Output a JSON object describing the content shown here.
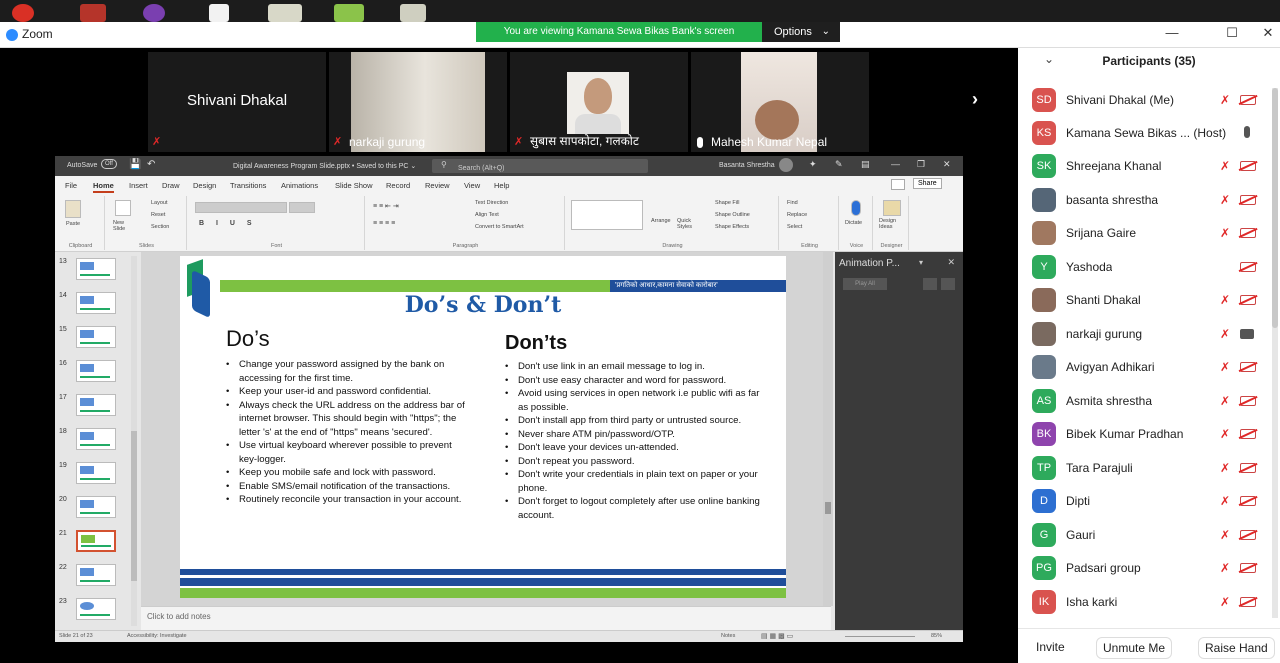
{
  "app": {
    "title": "Zoom"
  },
  "banner": {
    "viewing": "You are viewing Kamana Sewa Bikas Bank's screen",
    "options": "Options"
  },
  "video_tiles": [
    {
      "name": "Shivani Dhakal",
      "muted": true
    },
    {
      "name": "narkaji gurung",
      "muted": true
    },
    {
      "name": "सुबास सापकोटा, गलकोट",
      "muted": true
    },
    {
      "name": "Mahesh Kumar Nepal",
      "muted": false
    }
  ],
  "ppt": {
    "autosave": "AutoSave",
    "autosave_state": "Off",
    "filename": "Digital Awareness Program Slide.pptx • Saved to this PC ⌄",
    "search_placeholder": "Search (Alt+Q)",
    "user": "Basanta Shrestha",
    "share": "Share",
    "menu": [
      "File",
      "Home",
      "Insert",
      "Draw",
      "Design",
      "Transitions",
      "Animations",
      "Slide Show",
      "Record",
      "Review",
      "View",
      "Help"
    ],
    "ribbon": {
      "clipboard": "Clipboard",
      "paste": "Paste",
      "new_slide": "New Slide",
      "layout": "Layout",
      "reset": "Reset",
      "section": "Section",
      "slides": "Slides",
      "font": "Font",
      "paragraph": "Paragraph",
      "text_direction": "Text Direction",
      "align_text": "Align Text",
      "convert_smartart": "Convert to SmartArt",
      "drawing": "Drawing",
      "arrange": "Arrange",
      "quick_styles": "Quick Styles",
      "shape_fill": "Shape Fill",
      "shape_outline": "Shape Outline",
      "shape_effects": "Shape Effects",
      "find": "Find",
      "replace": "Replace",
      "select": "Select",
      "editing": "Editing",
      "dictate": "Dictate",
      "voice": "Voice",
      "design_ideas": "Design Ideas",
      "designer": "Designer"
    },
    "thumb_numbers": [
      "13",
      "14",
      "15",
      "16",
      "17",
      "18",
      "19",
      "20",
      "21",
      "22",
      "23"
    ],
    "notes_placeholder": "Click to add notes",
    "anim_title": "Animation P...",
    "play_all": "Play All",
    "status": {
      "slide": "Slide 21 of 23",
      "accessibility": "Accessibility: Investigate",
      "notes": "Notes",
      "zoom": "85%"
    }
  },
  "slide": {
    "tagline": "'प्रगतिको आधार,कामना सेवाको कारोबार'",
    "title": "Do’s & Don’t",
    "dos_heading": "Do’s",
    "donts_heading": "Don’ts",
    "dos": [
      "Change your password assigned by the bank on accessing for the first time.",
      "Keep your user-id and password confidential.",
      "Always check the URL address on the address bar of internet browser. This should begin with \"https\"; the letter 's' at the end of \"https\" means 'secured'.",
      "Use virtual keyboard wherever possible to prevent key-logger.",
      "Keep you mobile safe and lock with password.",
      "Enable SMS/email notification of the transactions.",
      "Routinely reconcile your transaction in your account."
    ],
    "donts": [
      "Don't use link in an email message to log in.",
      "Don't use easy character and word for password.",
      "Avoid using services in open network i.e public wifi as far as possible.",
      "Don't install app from third party or untrusted source.",
      "Never share ATM pin/password/OTP.",
      "Don't leave your devices un-attended.",
      "Don't repeat you password.",
      "Don't write your credentials in plain text on paper or your phone.",
      "Don't forget to logout completely after use online banking account."
    ]
  },
  "participants": {
    "title": "Participants (35)",
    "list": [
      {
        "initials": "SD",
        "color": "#d9534f",
        "name": "Shivani Dhakal (Me)",
        "mic": "muted",
        "cam": "off"
      },
      {
        "initials": "KS",
        "color": "#d9534f",
        "name": "Kamana Sewa Bikas ... (Host)",
        "mic": "on",
        "cam": "none"
      },
      {
        "initials": "SK",
        "color": "#2eaa5c",
        "name": "Shreejana Khanal",
        "mic": "muted",
        "cam": "off"
      },
      {
        "initials": "",
        "color": "#556677",
        "name": "basanta shrestha",
        "mic": "muted",
        "cam": "off"
      },
      {
        "initials": "",
        "color": "#a07860",
        "name": "Srijana Gaire",
        "mic": "muted",
        "cam": "off"
      },
      {
        "initials": "Y",
        "color": "#2eaa5c",
        "name": "Yashoda",
        "mic": "none",
        "cam": "off"
      },
      {
        "initials": "",
        "color": "#8a6a5a",
        "name": "Shanti Dhakal",
        "mic": "muted",
        "cam": "off"
      },
      {
        "initials": "",
        "color": "#7a6a60",
        "name": "narkaji gurung",
        "mic": "muted",
        "cam": "on"
      },
      {
        "initials": "",
        "color": "#6a7a8a",
        "name": "Avigyan Adhikari",
        "mic": "muted",
        "cam": "off"
      },
      {
        "initials": "AS",
        "color": "#2eaa5c",
        "name": "Asmita shrestha",
        "mic": "muted",
        "cam": "off"
      },
      {
        "initials": "BK",
        "color": "#8e44ad",
        "name": "Bibek Kumar Pradhan",
        "mic": "muted",
        "cam": "off"
      },
      {
        "initials": "TP",
        "color": "#2eaa5c",
        "name": "Tara Parajuli",
        "mic": "muted",
        "cam": "off"
      },
      {
        "initials": "D",
        "color": "#2d6fd1",
        "name": "Dipti",
        "mic": "muted",
        "cam": "off"
      },
      {
        "initials": "G",
        "color": "#2eaa5c",
        "name": "Gauri",
        "mic": "muted",
        "cam": "off"
      },
      {
        "initials": "PG",
        "color": "#2eaa5c",
        "name": "Padsari group",
        "mic": "muted",
        "cam": "off"
      },
      {
        "initials": "IK",
        "color": "#d9534f",
        "name": "Isha karki",
        "mic": "muted",
        "cam": "off"
      }
    ],
    "buttons": {
      "invite": "Invite",
      "unmute": "Unmute Me",
      "raise_hand": "Raise Hand"
    }
  }
}
